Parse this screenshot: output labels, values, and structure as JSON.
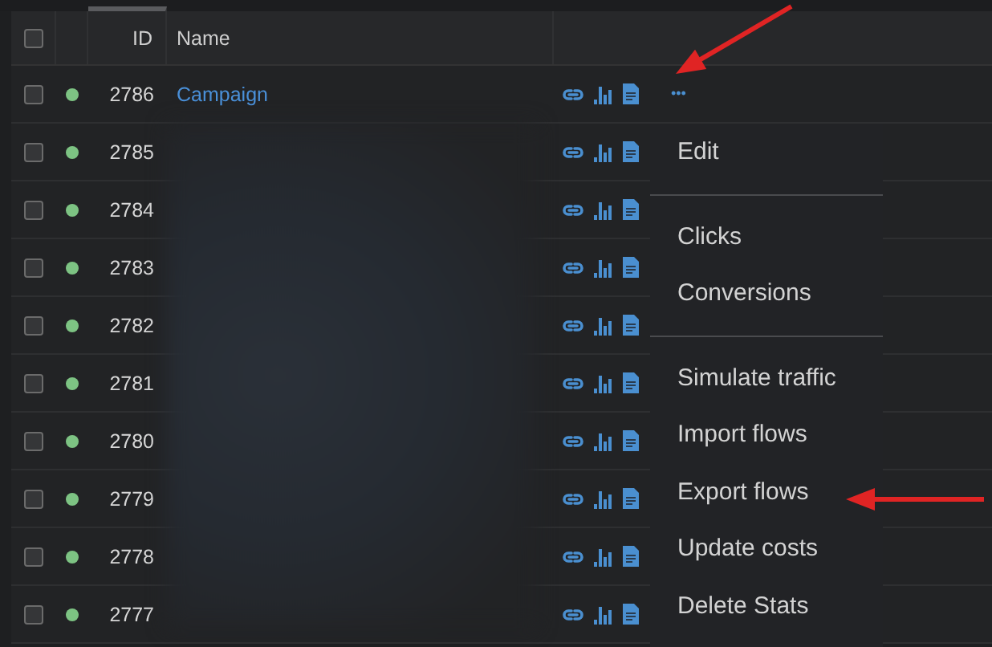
{
  "table": {
    "columns": [
      {
        "kind": "checkbox",
        "checked": false
      },
      {
        "kind": "status"
      },
      {
        "kind": "id",
        "label": "ID",
        "sorted": true
      },
      {
        "kind": "name",
        "label": "Name"
      },
      {
        "kind": "actions"
      }
    ],
    "rows": [
      {
        "checked": false,
        "color": "#7dc383",
        "id": "2786",
        "name": "Campaign",
        "more": "•••"
      },
      {
        "checked": false,
        "color": "#7dc383",
        "id": "2785"
      },
      {
        "checked": false,
        "color": "#7dc383",
        "id": "2784"
      },
      {
        "checked": false,
        "color": "#7dc383",
        "id": "2783"
      },
      {
        "checked": false,
        "color": "#7dc383",
        "id": "2782"
      },
      {
        "checked": false,
        "color": "#7dc383",
        "id": "2781"
      },
      {
        "checked": false,
        "color": "#7dc383",
        "id": "2780"
      },
      {
        "checked": false,
        "color": "#7dc383",
        "id": "2779"
      },
      {
        "checked": false,
        "color": "#7dc383",
        "id": "2778"
      },
      {
        "checked": false,
        "color": "#7dc383",
        "id": "2777"
      }
    ]
  },
  "context_menu": {
    "items": [
      {
        "kind": "item",
        "label": "Edit"
      },
      {
        "kind": "divider"
      },
      {
        "kind": "item",
        "label": "Clicks"
      },
      {
        "kind": "item",
        "label": "Conversions"
      },
      {
        "kind": "divider"
      },
      {
        "kind": "item",
        "label": "Simulate traffic"
      },
      {
        "kind": "item",
        "label": "Import flows"
      },
      {
        "kind": "item",
        "label": "Export flows"
      },
      {
        "kind": "item",
        "label": "Update costs"
      },
      {
        "kind": "item",
        "label": "Delete Stats"
      }
    ]
  },
  "annotations": [
    {
      "kind": "arrow"
    },
    {
      "kind": "arrow"
    }
  ]
}
